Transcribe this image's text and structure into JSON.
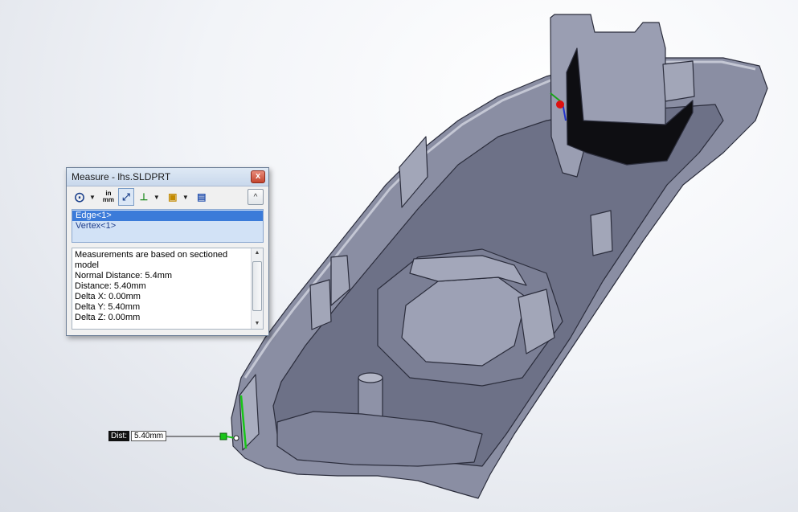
{
  "dialog": {
    "title": "Measure - lhs.SLDPRT",
    "close_label": "x",
    "toolbar": {
      "units_top": "in",
      "units_bottom": "mm",
      "collapse_label": "^"
    },
    "selections": [
      "Edge<1>",
      "Vertex<1>"
    ],
    "results": [
      "Measurements are based on sectioned",
      "model",
      "Normal Distance: 5.4mm",
      "Distance: 5.40mm",
      "Delta X: 0.00mm",
      "Delta Y: 5.40mm",
      "Delta Z: 0.00mm"
    ]
  },
  "callout": {
    "label": "Dist:",
    "value": "5.40mm"
  },
  "colors": {
    "part_fill": "#8a8ea3",
    "part_dark": "#3f4256",
    "measure_green": "#19c419",
    "selection_blue": "#3b7bd9"
  }
}
